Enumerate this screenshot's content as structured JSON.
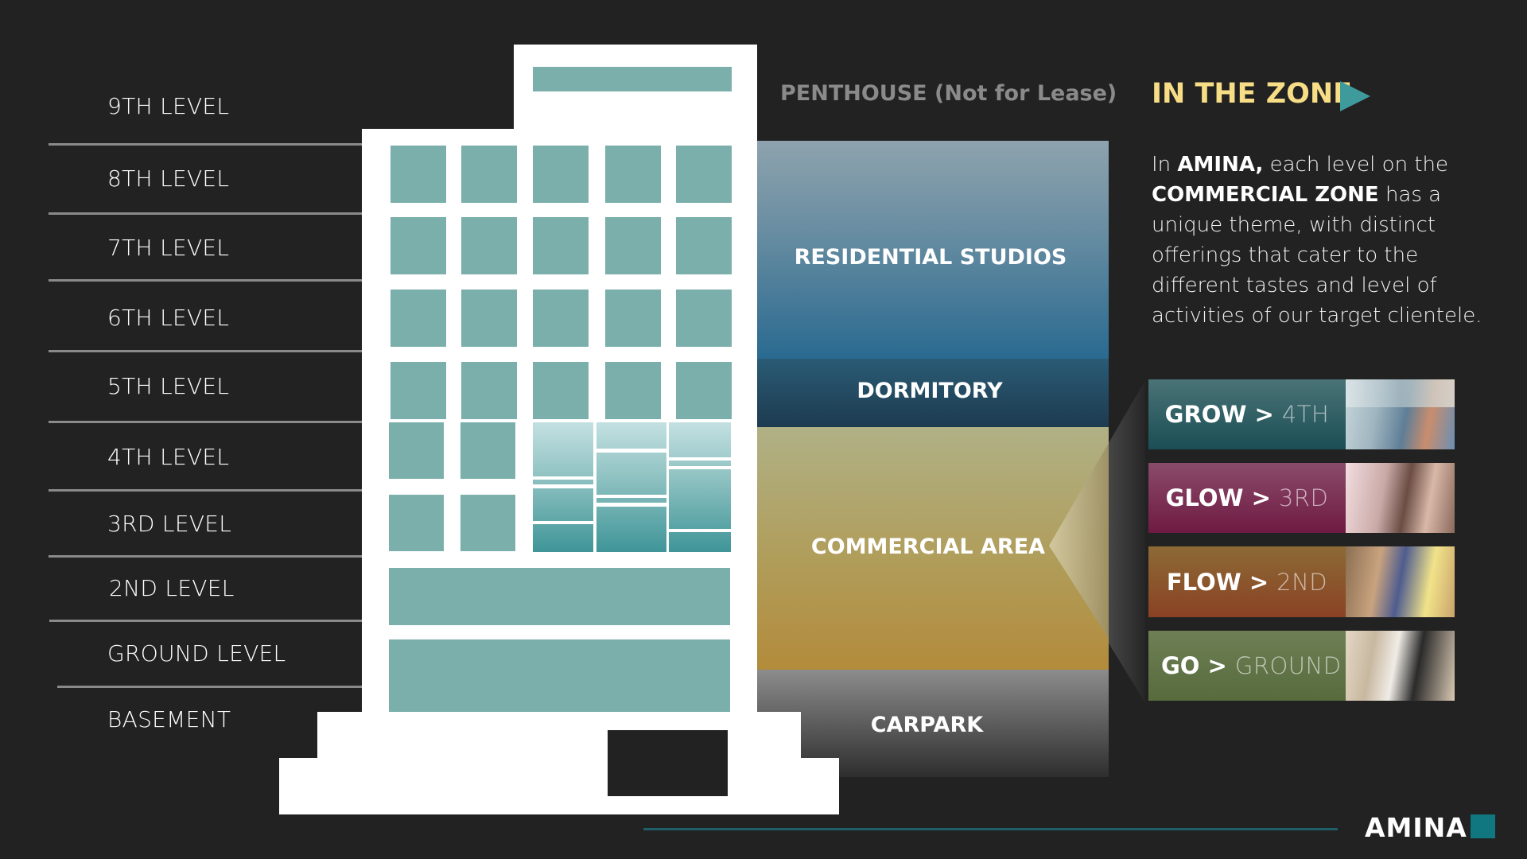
{
  "levels": [
    {
      "label": "9TH LEVEL"
    },
    {
      "label": "8TH LEVEL"
    },
    {
      "label": "7TH LEVEL"
    },
    {
      "label": "6TH LEVEL"
    },
    {
      "label": "5TH LEVEL"
    },
    {
      "label": "4TH LEVEL"
    },
    {
      "label": "3RD LEVEL"
    },
    {
      "label": "2ND LEVEL"
    },
    {
      "label": "GROUND LEVEL"
    },
    {
      "label": "BASEMENT"
    }
  ],
  "zones": {
    "penthouse": "PENTHOUSE (Not for Lease)",
    "residential": "RESIDENTIAL STUDIOS",
    "dormitory": "DORMITORY",
    "commercial": "COMMERCIAL AREA",
    "carpark": "CARPARK"
  },
  "panel": {
    "heading": "IN THE ZONE",
    "heading_icon": "play-triangle-icon",
    "body": {
      "t1": "In ",
      "b1": "AMINA,",
      "t2": " each level on the ",
      "b2": "COMMERCIAL ZONE",
      "t3": " has a unique theme, with distinct offerings that cater to the different tastes and level of activities of our target clientele."
    }
  },
  "cards": [
    {
      "name": "GROW >",
      "level": "4TH",
      "color": "#2f6166",
      "photo": "office-workers-photo"
    },
    {
      "name": "GLOW >",
      "level": "3RD",
      "color": "#7c2c53",
      "photo": "gym-fitness-photo"
    },
    {
      "name": "FLOW >",
      "level": "2ND",
      "color": "#8b5530",
      "photo": "friends-dining-photo"
    },
    {
      "name": "GO >",
      "level": "GROUND",
      "color": "#637549",
      "photo": "grocery-shopper-photo"
    }
  ],
  "colors": {
    "accent_yellow": "#f7dd86",
    "accent_teal": "#3f9a9c",
    "window_teal": "#7aafab",
    "brand_teal": "#10767f"
  },
  "footer": {
    "brand": "AMINA"
  }
}
